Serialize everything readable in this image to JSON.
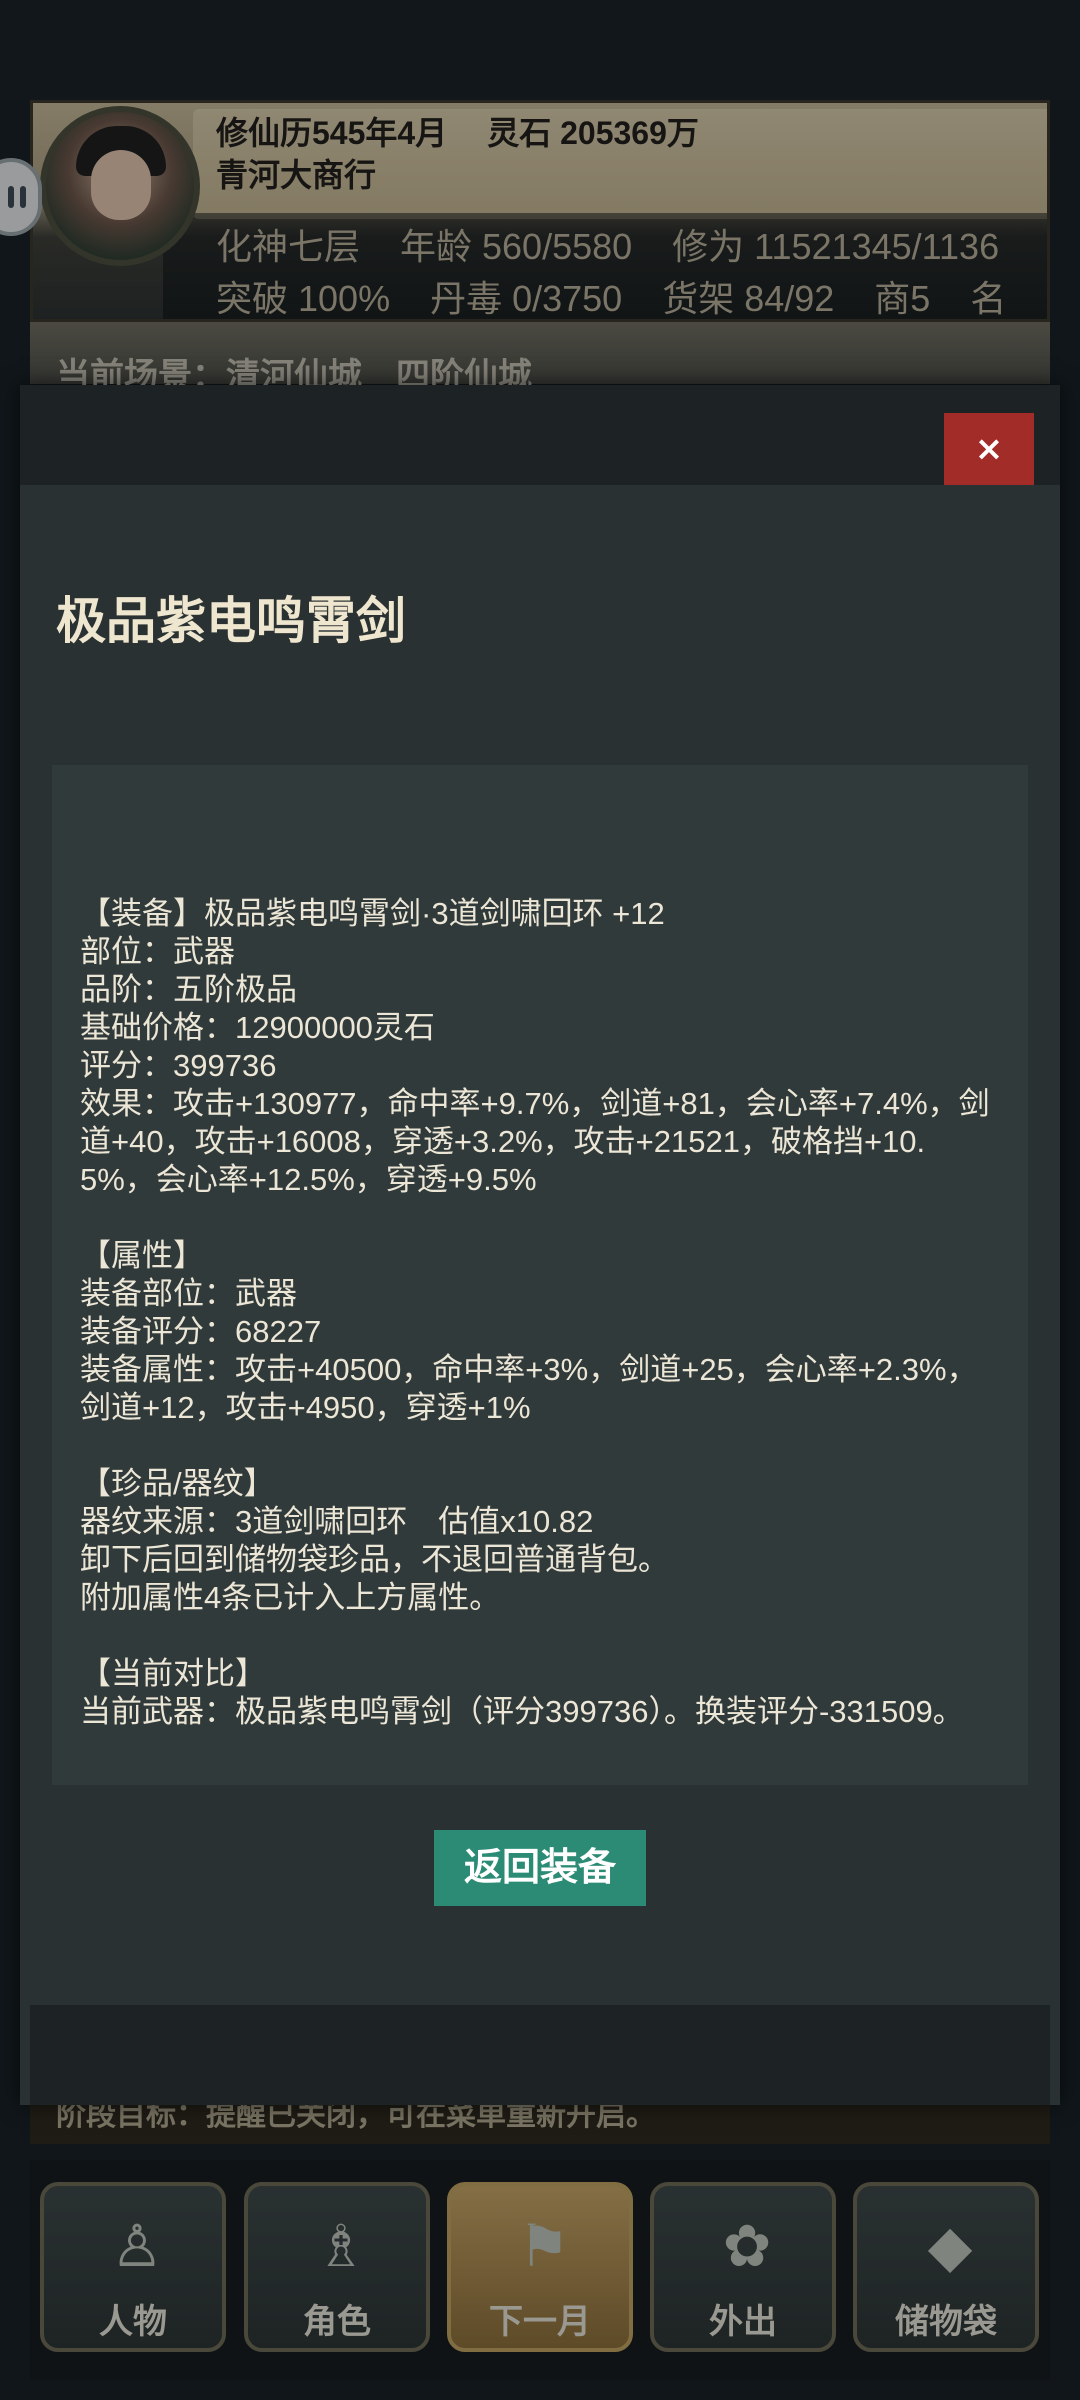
{
  "hud": {
    "calendar": "修仙历545年4月",
    "spirit_stones": "灵石 205369万",
    "shop_name": "青河大商行",
    "realm": "化神七层",
    "age": "年龄 560/5580",
    "cultivation": "修为 11521345/1136",
    "breakthrough": "突破 100%",
    "pill_toxicity": "丹毒 0/3750",
    "shelves": "货架 84/92",
    "merchants": "商5",
    "fame": "名"
  },
  "scene": {
    "text": "当前场景：清河仙城　四阶仙城"
  },
  "bottom_status": {
    "text": "阶段目标：提醒已关闭，可在菜单重新开启。"
  },
  "nav": [
    {
      "label": "人物",
      "icon": "person-icon"
    },
    {
      "label": "角色",
      "icon": "character-icon"
    },
    {
      "label": "下一月",
      "icon": "flag-icon"
    },
    {
      "label": "外出",
      "icon": "travel-icon"
    },
    {
      "label": "储物袋",
      "icon": "bag-icon"
    }
  ],
  "modal": {
    "close_label": "×",
    "title": "极品紫电鸣霄剑",
    "detail": "【装备】极品紫电鸣霄剑·3道剑啸回环 +12\n部位：武器\n品阶：五阶极品\n基础价格：12900000灵石\n评分：399736\n效果：攻击+130977，命中率+9.7%，剑道+81，会心率+7.4%，剑道+40，攻击+16008，穿透+3.2%，攻击+21521，破格挡+10.5%，会心率+12.5%，穿透+9.5%\n\n【属性】\n装备部位：武器\n装备评分：68227\n装备属性：攻击+40500，命中率+3%，剑道+25，会心率+2.3%，剑道+12，攻击+4950，穿透+1%\n\n【珍品/器纹】\n器纹来源：3道剑啸回环　估值x10.82\n卸下后回到储物袋珍品，不退回普通背包。\n附加属性4条已计入上方属性。\n\n【当前对比】\n当前武器：极品紫电鸣霄剑（评分399736）。换装评分-331509。",
    "return_label": "返回装备"
  },
  "colors": {
    "close_button": "#a12c28",
    "return_button": "#2c8b74",
    "modal_bg": "#2a3132"
  }
}
